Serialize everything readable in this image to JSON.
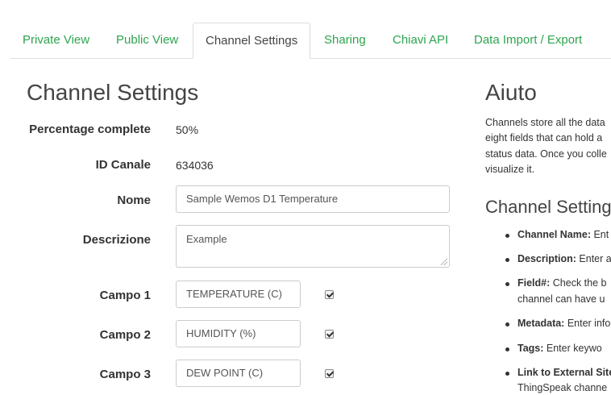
{
  "tabs": [
    {
      "label": "Private View"
    },
    {
      "label": "Public View"
    },
    {
      "label": "Channel Settings"
    },
    {
      "label": "Sharing"
    },
    {
      "label": "Chiavi API"
    },
    {
      "label": "Data Import / Export"
    }
  ],
  "settings": {
    "title": "Channel Settings",
    "percentage_label": "Percentage complete",
    "percentage_value": "50%",
    "id_label": "ID Canale",
    "id_value": "634036",
    "name_label": "Nome",
    "name_value": "Sample Wemos D1 Temperature",
    "description_label": "Descrizione",
    "description_value": "Example",
    "fields": [
      {
        "label": "Campo 1",
        "value": "TEMPERATURE (C)",
        "checked": true
      },
      {
        "label": "Campo 2",
        "value": "HUMIDITY (%)",
        "checked": true
      },
      {
        "label": "Campo 3",
        "value": "DEW POINT (C)",
        "checked": true
      }
    ]
  },
  "help": {
    "title": "Aiuto",
    "paragraph_lines": [
      "Channels store all the data",
      "eight fields that can hold a",
      "status data. Once you colle",
      "visualize it."
    ],
    "subtitle": "Channel Setting",
    "items": [
      {
        "term": "Channel Name:",
        "text": " Ent"
      },
      {
        "term": "Description:",
        "text": " Enter a"
      },
      {
        "term": "Field#:",
        "text": " Check the b"
      },
      {
        "term": "",
        "text": "channel can have u"
      },
      {
        "term": "Metadata:",
        "text": " Enter info"
      },
      {
        "term": "Tags:",
        "text": " Enter keywo"
      },
      {
        "term": "Link to External Site",
        "text": ""
      },
      {
        "term": "",
        "text": "ThingSpeak channe"
      }
    ]
  }
}
